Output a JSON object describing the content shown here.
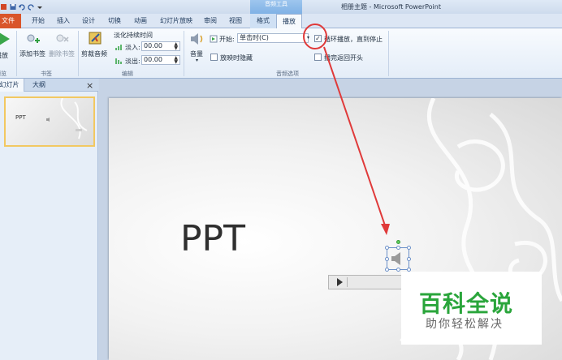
{
  "titlebar": {
    "doc_title": "相册主题 - Microsoft PowerPoint",
    "context_group": "音频工具"
  },
  "tabs": [
    "文件",
    "开始",
    "插入",
    "设计",
    "切换",
    "动画",
    "幻灯片放映",
    "审阅",
    "视图",
    "格式",
    "播放"
  ],
  "ribbon": {
    "play_partial": "播放",
    "add_bookmark": "添加书签",
    "remove_bookmark": "删除书签",
    "trim_audio": "剪裁音频",
    "fade_duration": "淡化持续时间",
    "fade_in_label": "淡入:",
    "fade_in_value": "00.00",
    "fade_out_label": "淡出:",
    "fade_out_value": "00.00",
    "volume": "音量",
    "start_label": "开始:",
    "start_value": "单击时(C)",
    "hide_during_show": "放映时隐藏",
    "loop_until_stopped": "循环播放，直到停止",
    "rewind_after_playing": "播完返回开头",
    "group_preview_partial": "预览",
    "group_bookmarks": "书签",
    "group_editing": "编辑",
    "group_audio_options": "音频选项"
  },
  "leftpane": {
    "tab_slides": "幻灯片",
    "tab_outline": "大纲",
    "close": "×",
    "thumb_title": "PPT"
  },
  "slide": {
    "title": "PPT"
  },
  "watermark": {
    "main": "百科全说",
    "sub": "助你轻松解决"
  },
  "colors": {
    "file_tab": "#d9552a",
    "context_tab": "#7fb1e5",
    "annotation": "#e03a3a",
    "watermark_green": "#2aa53b"
  }
}
